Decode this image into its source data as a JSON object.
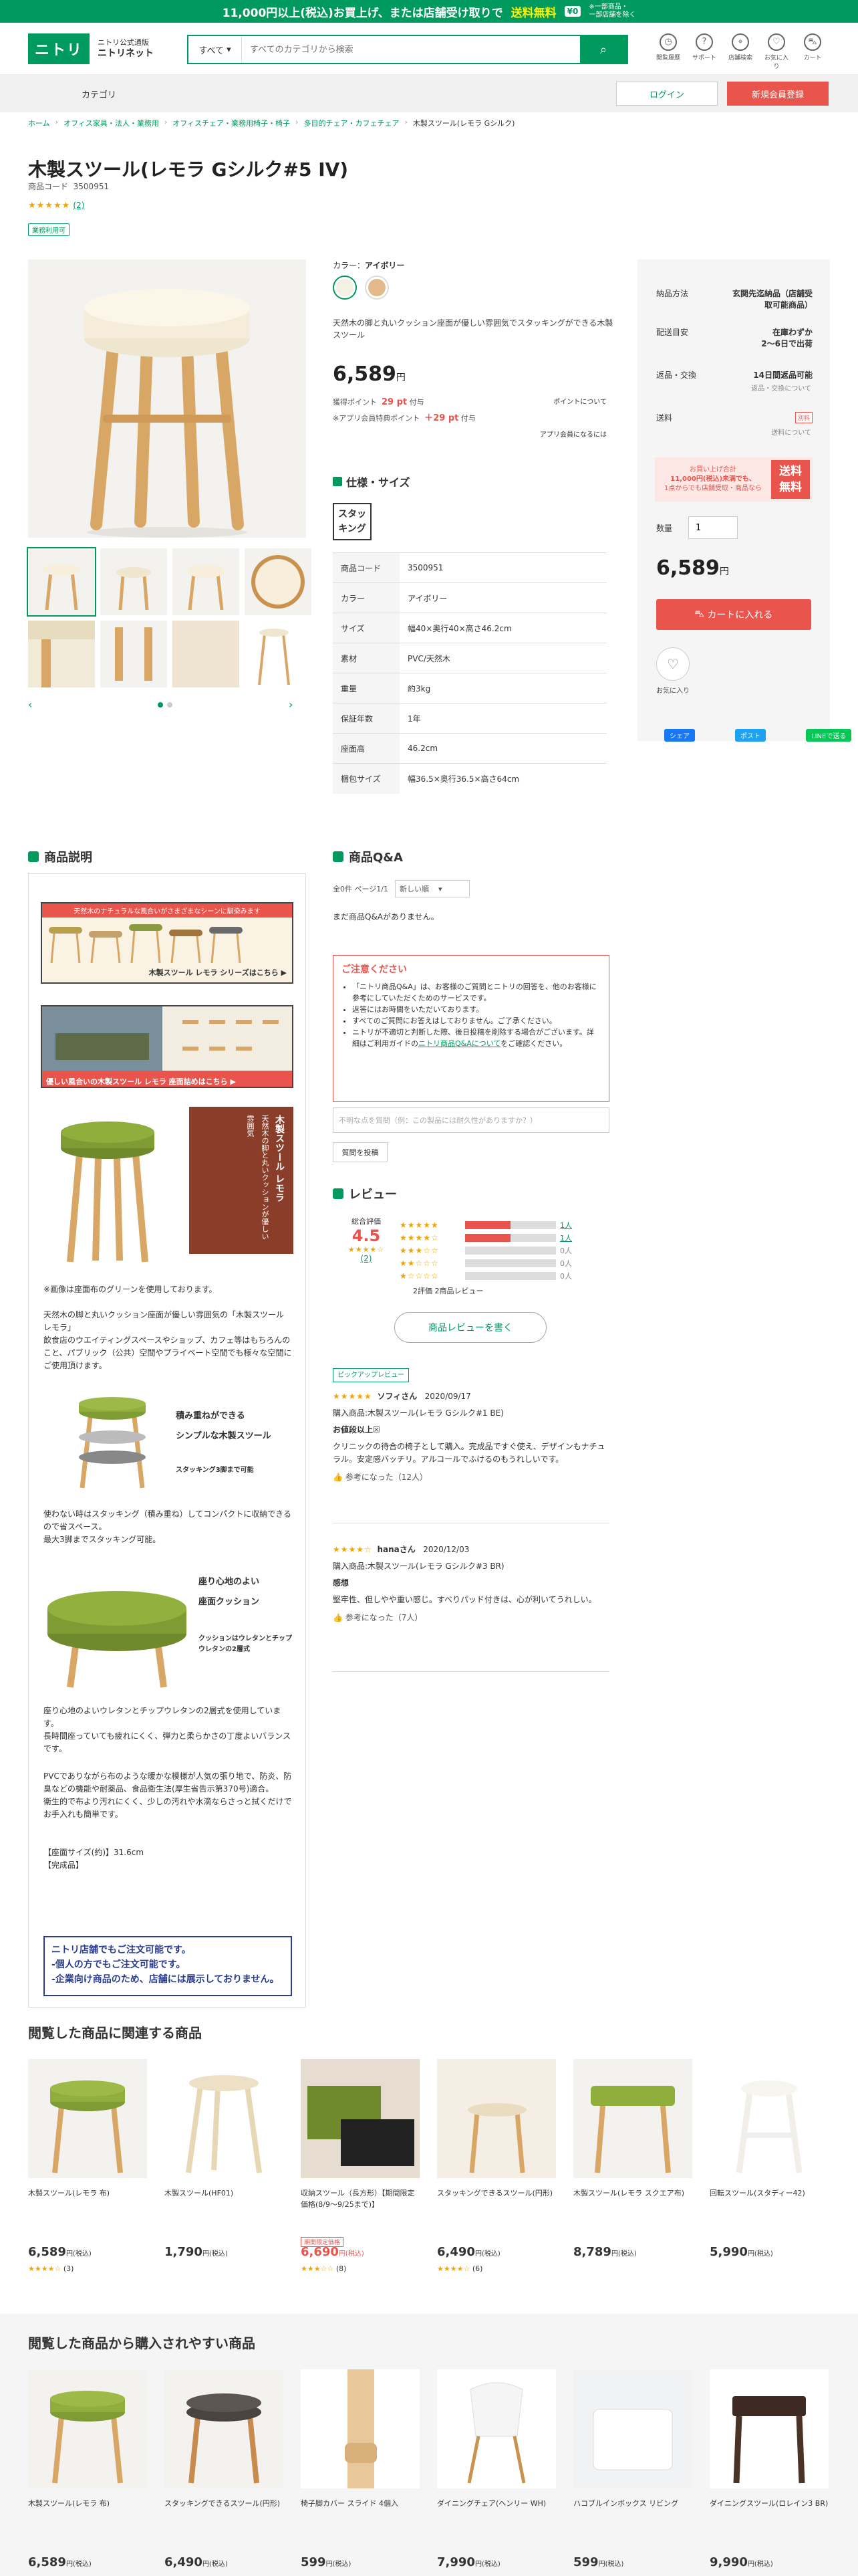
{
  "banner": {
    "line1": "11,000円以上(税込)お買上げ、または店舗受け取りで",
    "line2": "送料無料",
    "pill": "¥0",
    "small1": "※一部商品・",
    "small2": "一部店舗を除く"
  },
  "header": {
    "logo": "ニトリ",
    "sub1": "ニトリ公式通販",
    "sub2": "ニトリネット",
    "search_category": "すべて",
    "search_placeholder": "すべてのカテゴリから検索",
    "icons": [
      {
        "label": "閲覧履歴",
        "glyph": "◷"
      },
      {
        "label": "サポート",
        "glyph": "?"
      },
      {
        "label": "店舗検索",
        "glyph": "⌖"
      },
      {
        "label": "お気に入り",
        "glyph": "♡"
      },
      {
        "label": "カート",
        "glyph": "⛍"
      }
    ]
  },
  "catbar": {
    "category": "カテゴリ",
    "login": "ログイン",
    "register": "新規会員登録"
  },
  "breadcrumb": [
    "ホーム",
    "オフィス家具・法人・業務用",
    "オフィスチェア・業務用椅子・椅子",
    "多目的チェア・カフェチェア",
    "木製スツール(レモラ Gシルク)"
  ],
  "product": {
    "title": "木製スツール(レモラ Gシルク#5 IV)",
    "code_label": "商品コード",
    "code": "3500951",
    "rating_stars": "★★★★★",
    "review_count": "(2)",
    "tag": "業務利用可",
    "color_label": "カラー：",
    "color_value": "アイボリー",
    "swatches": [
      "#f4f0e3",
      "#e2b98a"
    ],
    "description": "天然木の脚と丸いクッション座面が優しい雰囲気でスタッキングができる木製スツール",
    "price": "6,589",
    "yen": "円",
    "points_label": "獲得ポイント",
    "points": "29 pt",
    "points_suffix": "付与",
    "points_link": "ポイントについて",
    "app_label": "※アプリ会員特典ポイント",
    "app_points": "＋29 pt",
    "app_link": "アプリ会員になるには"
  },
  "spec": {
    "heading": "仕様・サイズ",
    "stack_badge1": "スタッ",
    "stack_badge2": "キング",
    "rows": [
      {
        "k": "商品コード",
        "v": "3500951"
      },
      {
        "k": "カラー",
        "v": "アイボリー"
      },
      {
        "k": "サイズ",
        "v": "幅40×奥行40×高さ46.2cm"
      },
      {
        "k": "素材",
        "v": "PVC/天然木"
      },
      {
        "k": "重量",
        "v": "約3kg"
      },
      {
        "k": "保証年数",
        "v": "1年"
      },
      {
        "k": "座面高",
        "v": "46.2cm"
      },
      {
        "k": "梱包サイズ",
        "v": "幅36.5×奥行36.5×高さ64cm"
      }
    ]
  },
  "buybox": {
    "delivery_label": "納品方法",
    "delivery_value": "玄関先迄納品（店舗受取可能商品）",
    "date_label": "配送目安",
    "date_value": "在庫わずか",
    "date_value2": "2〜6日で出荷",
    "return_label": "返品・交換",
    "return_value": "14日間返品可能",
    "return_sub": "返品・交換について",
    "ship_label": "送料",
    "ship_badge": "別料",
    "ship_sub": "送料について",
    "promo1": "お買い上げ合計",
    "promo2": "11,000円(税込)未満でも、",
    "promo3": "1点からでも店舗受取・商品なら",
    "promo_free1": "送料",
    "promo_free2": "無料",
    "qty_label": "数量",
    "qty_value": "1",
    "price": "6,589",
    "yen": "円",
    "cart": "カートに入れる",
    "fav": "お気に入り"
  },
  "share": {
    "fb": "シェア",
    "tw": "ポスト",
    "line": "LINEで送る"
  },
  "description": {
    "heading": "商品説明",
    "banner1_top": "天然木のナチュラルな風合いがさまざまなシーンに馴染みます",
    "banner1_bottom": "木製スツール レモラ シリーズはこちら ▶",
    "banner2_bottom": "優しい風合いの木製スツール レモラ 座面詰めはこちら ▶",
    "promo_title": "木製スツール レモラ",
    "promo_vert": "天然木の脚と丸いクッションが優しい雰囲気",
    "note1": "※画像は座面布のグリーンを使用しております。",
    "text1": "天然木の脚と丸いクッション座面が優しい雰囲気の「木製スツール レモラ」",
    "text2": "飲食店のウエイティングスペースやショップ、カフェ等はもちろんのこと、パブリック（公共）空間やプライベート空間でも様々な空間にご使用頂けます。",
    "stack_title1": "積み重ねができる",
    "stack_title2": "シンプルな木製スツール",
    "stack_note": "スタッキング3脚まで可能",
    "text3": "使わない時はスタッキング（積み重ね）してコンパクトに収納できるので省スペース。",
    "text4": "最大3脚までスタッキング可能。",
    "cushion_title1": "座り心地のよい",
    "cushion_title2": "座面クッション",
    "cushion_note": "クッションはウレタンとチップウレタンの2層式",
    "text5": "座り心地のよいウレタンとチップウレタンの2層式を使用しています。",
    "text6": "長時間座っていても疲れにくく、弾力と柔らかさの丁度よいバランスです。",
    "text7": "PVCでありながら布のような暖かな模様が人気の張り地で、防炎、防臭などの機能や耐薬品、食品衛生法(厚生省告示第370号)適合。",
    "text8": "衛生的で布より汚れにくく、少しの汚れや水滴ならさっと拭くだけでお手入れも簡単です。",
    "text9": "【座面サイズ(約)】31.6cm",
    "text10": "【完成品】",
    "shop1": "ニトリ店舗でもご注文可能です。",
    "shop2": "-個人の方でもご注文可能です。",
    "shop3": "-企業向け商品のため、店舗には展示しておりません。"
  },
  "qa": {
    "heading": "商品Q&A",
    "count": "全0件 ページ1/1",
    "sort": "新しい順",
    "empty": "まだ商品Q&Aがありません。",
    "caution_title": "ご注意ください",
    "caution_items": [
      "「ニトリ商品Q&A」は、お客様のご質問とニトリの回答を、他のお客様に参考にしていただくためのサービスです。",
      "返答にはお時間をいただいております。",
      "すべてのご質問にお答えはしておりません。ご了承ください。"
    ],
    "caution_last": "ニトリが不適切と判断した際、後日投稿を削除する場合がございます。詳細はご利用ガイドの",
    "caution_link": "ニトリ商品Q&Aについて",
    "caution_tail": "をご確認ください。",
    "input_placeholder": "不明な点を質問（例：この製品には耐久性がありますか？）",
    "post": "質問を投稿"
  },
  "reviews": {
    "heading": "レビュー",
    "total_label": "総合評価",
    "avg": "4.5",
    "avg_stars": "★★★★☆",
    "avg_count": "(2)",
    "bars": [
      {
        "stars": "★★★★★",
        "fill": 0.5,
        "n": "1人"
      },
      {
        "stars": "★★★★☆",
        "fill": 0.5,
        "n": "1人"
      },
      {
        "stars": "★★★☆☆",
        "fill": 0,
        "n": "0人"
      },
      {
        "stars": "★★☆☆☆",
        "fill": 0,
        "n": "0人"
      },
      {
        "stars": "★☆☆☆☆",
        "fill": 0,
        "n": "0人"
      }
    ],
    "summary": "2評価 2商品レビュー",
    "write": "商品レビューを書く",
    "items": [
      {
        "pickup": "ピックアップレビュー",
        "stars": "★★★★★",
        "user": "ソフィさん",
        "date": "2020/09/17",
        "product": "購入商品:木製スツール(レモラ Gシルク#1 BE)",
        "title": "お値段以上☒",
        "body": "クリニックの待合の椅子として購入。完成品ですぐ使え、デザインもナチュラル。安定感バッチリ。アルコールでふけるのもうれしいです。",
        "helpful": "参考になった（12人）"
      },
      {
        "stars": "★★★★☆",
        "user": "hanaさん",
        "date": "2020/12/03",
        "product": "購入商品:木製スツール(レモラ Gシルク#3 BR)",
        "title": "感想",
        "body": "堅牢性、但しやや重い感じ。すべりパッド付きは、心が利いてうれしい。",
        "helpful": "参考になった（7人）"
      }
    ]
  },
  "related": {
    "heading": "閲覧した商品に関連する商品",
    "items": [
      {
        "name": "木製スツール(レモラ 布)",
        "price": "6,589",
        "tax": "円(税込)",
        "stars": "★★★★☆",
        "count": "(3)",
        "red": false,
        "tag": ""
      },
      {
        "name": "木製スツール(HF01)",
        "price": "1,790",
        "tax": "円(税込)",
        "stars": "",
        "count": "",
        "red": false,
        "tag": ""
      },
      {
        "name": "収納スツール（長方形）【期間限定価格(8/9〜9/25まで)】",
        "price": "6,690",
        "tax": "円(税込)",
        "stars": "★★★☆☆",
        "count": "(8)",
        "red": true,
        "tag": "期間限定価格"
      },
      {
        "name": "スタッキングできるスツール(円形)",
        "price": "6,490",
        "tax": "円(税込)",
        "stars": "★★★★☆",
        "count": "(6)",
        "red": false,
        "tag": ""
      },
      {
        "name": "木製スツール(レモラ スクエア布)",
        "price": "8,789",
        "tax": "円(税込)",
        "stars": "",
        "count": "",
        "red": false,
        "tag": ""
      },
      {
        "name": "回転スツール(スタディー42)",
        "price": "5,990",
        "tax": "円(税込)",
        "stars": "",
        "count": "",
        "red": false,
        "tag": ""
      }
    ]
  },
  "related2": {
    "heading": "閲覧した商品から購入されやすい商品",
    "items": [
      {
        "name": "木製スツール(レモラ 布)",
        "price": "6,589",
        "tax": "円(税込)"
      },
      {
        "name": "スタッキングできるスツール(円形)",
        "price": "6,490",
        "tax": "円(税込)"
      },
      {
        "name": "椅子脚カバー スライド 4個入",
        "price": "599",
        "tax": "円(税込)"
      },
      {
        "name": "ダイニングチェア(ヘンリー WH)",
        "price": "7,990",
        "tax": "円(税込)"
      },
      {
        "name": "ハコブルインボックス リビング",
        "price": "599",
        "tax": "円(税込)"
      },
      {
        "name": "ダイニングスツール(ロレイン3 BR)",
        "price": "9,990",
        "tax": "円(税込)"
      }
    ]
  }
}
